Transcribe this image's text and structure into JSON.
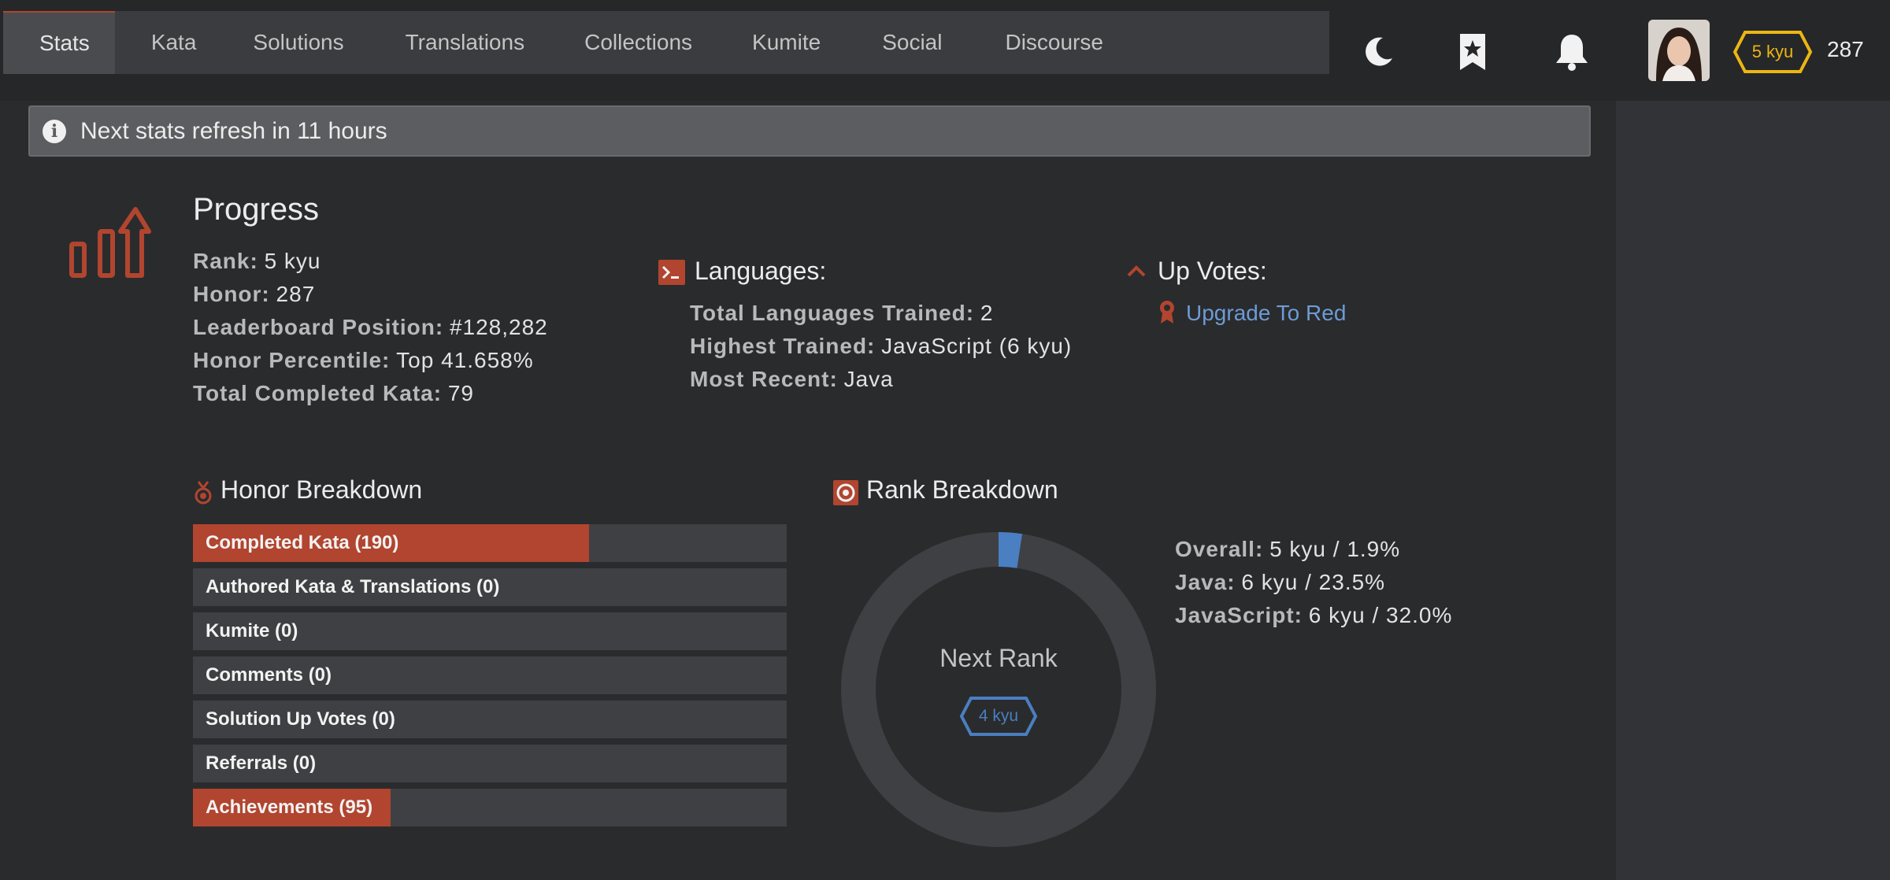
{
  "nav": {
    "tabs": [
      {
        "label": "Stats",
        "active": true
      },
      {
        "label": "Kata"
      },
      {
        "label": "Solutions"
      },
      {
        "label": "Translations"
      },
      {
        "label": "Collections"
      },
      {
        "label": "Kumite"
      },
      {
        "label": "Social"
      },
      {
        "label": "Discourse"
      }
    ]
  },
  "header": {
    "icons": [
      "moon-icon",
      "bookmark-star-icon",
      "bell-icon"
    ],
    "rank_badge": "5 kyu",
    "honor": "287"
  },
  "notice": {
    "text": "Next stats refresh in 11 hours"
  },
  "progress": {
    "title": "Progress",
    "rank_label": "Rank:",
    "rank_value": "5 kyu",
    "honor_label": "Honor:",
    "honor_value": "287",
    "leaderboard_label": "Leaderboard Position:",
    "leaderboard_value": "#128,282",
    "percentile_label": "Honor Percentile:",
    "percentile_value": "Top 41.658%",
    "completed_label": "Total Completed Kata:",
    "completed_value": "79"
  },
  "languages": {
    "title": "Languages:",
    "total_label": "Total Languages Trained:",
    "total_value": "2",
    "highest_label": "Highest Trained:",
    "highest_value": "JavaScript (6 kyu)",
    "recent_label": "Most Recent:",
    "recent_value": "Java"
  },
  "upvotes": {
    "title": "Up Votes:",
    "link": "Upgrade To Red"
  },
  "honor_breakdown": {
    "title": "Honor Breakdown",
    "bars": [
      {
        "label": "Completed Kata (190)",
        "fill": 0.667
      },
      {
        "label": "Authored Kata & Translations (0)",
        "fill": 0
      },
      {
        "label": "Kumite (0)",
        "fill": 0
      },
      {
        "label": "Comments (0)",
        "fill": 0
      },
      {
        "label": "Solution Up Votes (0)",
        "fill": 0
      },
      {
        "label": "Referrals (0)",
        "fill": 0
      },
      {
        "label": "Achievements (95)",
        "fill": 0.333
      }
    ]
  },
  "rank_breakdown": {
    "title": "Rank Breakdown",
    "center_label": "Next Rank",
    "next_rank": "4 kyu",
    "progress": 0.019,
    "overall_label": "Overall:",
    "overall_value": "5 kyu / 1.9%",
    "java_label": "Java:",
    "java_value": "6 kyu / 23.5%",
    "js_label": "JavaScript:",
    "js_value": "6 kyu / 32.0%"
  },
  "colors": {
    "accent": "#b1452f",
    "link": "#6d9bd4",
    "badge_yellow": "#ecb613",
    "badge_blue": "#4a7fc1"
  }
}
